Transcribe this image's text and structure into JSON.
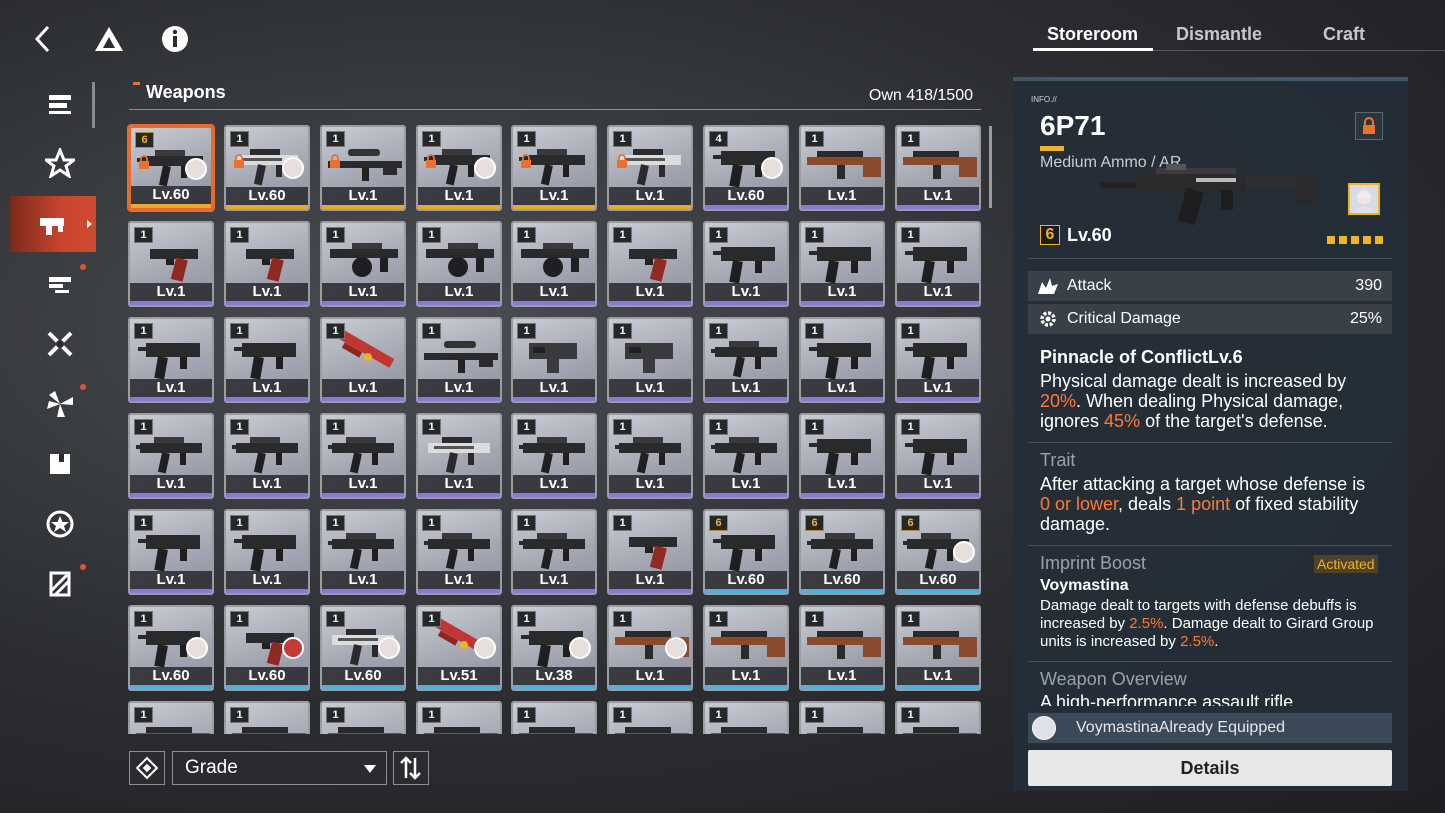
{
  "sidebar_badges": [
    false,
    false,
    false,
    true,
    false,
    true,
    false,
    false,
    true
  ],
  "list": {
    "title": "Weapons",
    "own": "Own 418/1500"
  },
  "filters": {
    "sort_label": "Grade"
  },
  "tabs": [
    "Storeroom",
    "Dismantle",
    "Craft"
  ],
  "detail": {
    "info_tag": "INFO.//",
    "name": "6P71",
    "type": "Medium Ammo / AR",
    "rank": "6",
    "level": "Lv.60",
    "stats": [
      {
        "label": "Attack",
        "value": "390"
      },
      {
        "label": "Critical Damage",
        "value": "25%"
      }
    ],
    "skill": {
      "title": "Pinnacle of ConflictLv.6",
      "t1": "Physical damage dealt is increased by ",
      "h1": "20%",
      "t2": ". When dealing Physical damage, ignores ",
      "h2": "45%",
      "t3": " of the target's defense."
    },
    "trait": {
      "heading": "Trait",
      "t1": "After attacking a target whose defense is ",
      "h1": "0 or lower",
      "t2": ", deals ",
      "h2": "1 point",
      "t3": " of fixed stability damage."
    },
    "imprint": {
      "heading": "Imprint Boost",
      "status": "Activated",
      "name": "Voymastina",
      "t1": "Damage dealt to targets with defense debuffs is increased by ",
      "h1": "2.5%",
      "t2": ". Damage dealt to Girard Group units is increased by ",
      "h2": "2.5%",
      "t3": "."
    },
    "overview": {
      "heading": "Weapon Overview",
      "text": "A high-performance assault rifle"
    },
    "equipped": "VoymastinaAlready Equipped",
    "details_button": "Details"
  },
  "colors": {
    "accent": "#e8722e",
    "highlight": "#ff7a33",
    "selected_border": "#e86a2c"
  },
  "grid": {
    "rows": [
      [
        {
          "rank": "6",
          "gold": true,
          "lock": true,
          "avatar": true,
          "lv": "Lv.60",
          "strip": "orange",
          "gun": "ar"
        },
        {
          "rank": "1",
          "lock": true,
          "avatar": true,
          "lv": "Lv.60",
          "strip": "orange",
          "gun": "ar2"
        },
        {
          "rank": "1",
          "lock": true,
          "lv": "Lv.1",
          "strip": "orange",
          "gun": "sniper"
        },
        {
          "rank": "1",
          "lock": true,
          "avatar": true,
          "lv": "Lv.1",
          "strip": "orange",
          "gun": "ar"
        },
        {
          "rank": "1",
          "lock": true,
          "lv": "Lv.1",
          "strip": "orange",
          "gun": "ar"
        },
        {
          "rank": "1",
          "lock": true,
          "lv": "Lv.1",
          "strip": "orange",
          "gun": "ar2"
        },
        {
          "rank": "4",
          "avatar": true,
          "lv": "Lv.60",
          "strip": "purple",
          "gun": "smg"
        },
        {
          "rank": "1",
          "lv": "Lv.1",
          "strip": "purple",
          "gun": "rifle"
        },
        {
          "rank": "1",
          "lv": "Lv.1",
          "strip": "purple",
          "gun": "rifle"
        }
      ],
      [
        {
          "rank": "1",
          "lv": "Lv.1",
          "strip": "purple",
          "gun": "pistol"
        },
        {
          "rank": "1",
          "lv": "Lv.1",
          "strip": "purple",
          "gun": "pistol"
        },
        {
          "rank": "1",
          "lv": "Lv.1",
          "strip": "purple",
          "gun": "mg"
        },
        {
          "rank": "1",
          "lv": "Lv.1",
          "strip": "purple",
          "gun": "mg"
        },
        {
          "rank": "1",
          "lv": "Lv.1",
          "strip": "purple",
          "gun": "mg"
        },
        {
          "rank": "1",
          "lv": "Lv.1",
          "strip": "purple",
          "gun": "pistol"
        },
        {
          "rank": "1",
          "lv": "Lv.1",
          "strip": "purple",
          "gun": "smg"
        },
        {
          "rank": "1",
          "lv": "Lv.1",
          "strip": "purple",
          "gun": "smg"
        },
        {
          "rank": "1",
          "lv": "Lv.1",
          "strip": "purple",
          "gun": "smg"
        }
      ],
      [
        {
          "rank": "1",
          "lv": "Lv.1",
          "strip": "purple",
          "gun": "smg"
        },
        {
          "rank": "1",
          "lv": "Lv.1",
          "strip": "purple",
          "gun": "smg"
        },
        {
          "rank": "1",
          "lv": "Lv.1",
          "strip": "purple",
          "gun": "red"
        },
        {
          "rank": "1",
          "lv": "Lv.1",
          "strip": "purple",
          "gun": "sniper"
        },
        {
          "rank": "1",
          "lv": "Lv.1",
          "strip": "purple",
          "gun": "pdw"
        },
        {
          "rank": "1",
          "lv": "Lv.1",
          "strip": "purple",
          "gun": "pdw"
        },
        {
          "rank": "1",
          "lv": "Lv.1",
          "strip": "purple",
          "gun": "ar"
        },
        {
          "rank": "1",
          "lv": "Lv.1",
          "strip": "purple",
          "gun": "smg"
        },
        {
          "rank": "1",
          "lv": "Lv.1",
          "strip": "purple",
          "gun": "smg"
        }
      ],
      [
        {
          "rank": "1",
          "lv": "Lv.1",
          "strip": "purple",
          "gun": "ar"
        },
        {
          "rank": "1",
          "lv": "Lv.1",
          "strip": "purple",
          "gun": "ar"
        },
        {
          "rank": "1",
          "lv": "Lv.1",
          "strip": "purple",
          "gun": "ar"
        },
        {
          "rank": "1",
          "lv": "Lv.1",
          "strip": "purple",
          "gun": "ar2"
        },
        {
          "rank": "1",
          "lv": "Lv.1",
          "strip": "purple",
          "gun": "ar"
        },
        {
          "rank": "1",
          "lv": "Lv.1",
          "strip": "purple",
          "gun": "ar"
        },
        {
          "rank": "1",
          "lv": "Lv.1",
          "strip": "purple",
          "gun": "ar"
        },
        {
          "rank": "1",
          "lv": "Lv.1",
          "strip": "purple",
          "gun": "smg"
        },
        {
          "rank": "1",
          "lv": "Lv.1",
          "strip": "purple",
          "gun": "smg"
        }
      ],
      [
        {
          "rank": "1",
          "lv": "Lv.1",
          "strip": "purple",
          "gun": "smg"
        },
        {
          "rank": "1",
          "lv": "Lv.1",
          "strip": "purple",
          "gun": "smg"
        },
        {
          "rank": "1",
          "lv": "Lv.1",
          "strip": "purple",
          "gun": "ar"
        },
        {
          "rank": "1",
          "lv": "Lv.1",
          "strip": "purple",
          "gun": "ar"
        },
        {
          "rank": "1",
          "lv": "Lv.1",
          "strip": "purple",
          "gun": "ar"
        },
        {
          "rank": "1",
          "lv": "Lv.1",
          "strip": "purple",
          "gun": "pistol"
        },
        {
          "rank": "6",
          "gold": true,
          "lv": "Lv.60",
          "strip": "blue",
          "gun": "smg"
        },
        {
          "rank": "6",
          "gold": true,
          "lv": "Lv.60",
          "strip": "blue",
          "gun": "ar"
        },
        {
          "rank": "6",
          "gold": true,
          "avatar": true,
          "lv": "Lv.60",
          "strip": "blue",
          "gun": "ar"
        }
      ],
      [
        {
          "rank": "1",
          "avatar": true,
          "lv": "Lv.60",
          "strip": "blue",
          "gun": "smg"
        },
        {
          "rank": "1",
          "avatar": true,
          "lv": "Lv.60",
          "strip": "blue",
          "gun": "pistol"
        },
        {
          "rank": "1",
          "avatar": true,
          "lv": "Lv.60",
          "strip": "blue",
          "gun": "ar2"
        },
        {
          "rank": "1",
          "avatar": true,
          "lv": "Lv.51",
          "strip": "blue",
          "gun": "red"
        },
        {
          "rank": "1",
          "avatar": true,
          "lv": "Lv.38",
          "strip": "blue",
          "gun": "smg"
        },
        {
          "rank": "1",
          "avatar": true,
          "lv": "Lv.1",
          "strip": "blue",
          "gun": "rifle"
        },
        {
          "rank": "1",
          "lv": "Lv.1",
          "strip": "blue",
          "gun": "rifle"
        },
        {
          "rank": "1",
          "lv": "Lv.1",
          "strip": "blue",
          "gun": "rifle"
        },
        {
          "rank": "1",
          "lv": "Lv.1",
          "strip": "blue",
          "gun": "rifle"
        }
      ],
      [
        {
          "rank": "1",
          "lv": "",
          "strip": "blue",
          "gun": "rifle"
        },
        {
          "rank": "1",
          "lv": "",
          "strip": "blue",
          "gun": "rifle"
        },
        {
          "rank": "1",
          "lv": "",
          "strip": "blue",
          "gun": "rifle"
        },
        {
          "rank": "1",
          "lv": "",
          "strip": "blue",
          "gun": "rifle"
        },
        {
          "rank": "1",
          "lv": "",
          "strip": "blue",
          "gun": "rifle"
        },
        {
          "rank": "1",
          "lv": "",
          "strip": "blue",
          "gun": "rifle"
        },
        {
          "rank": "1",
          "lv": "",
          "strip": "blue",
          "gun": "rifle"
        },
        {
          "rank": "1",
          "lv": "",
          "strip": "blue",
          "gun": "rifle"
        },
        {
          "rank": "1",
          "lv": "",
          "strip": "blue",
          "gun": "rifle"
        }
      ]
    ]
  }
}
